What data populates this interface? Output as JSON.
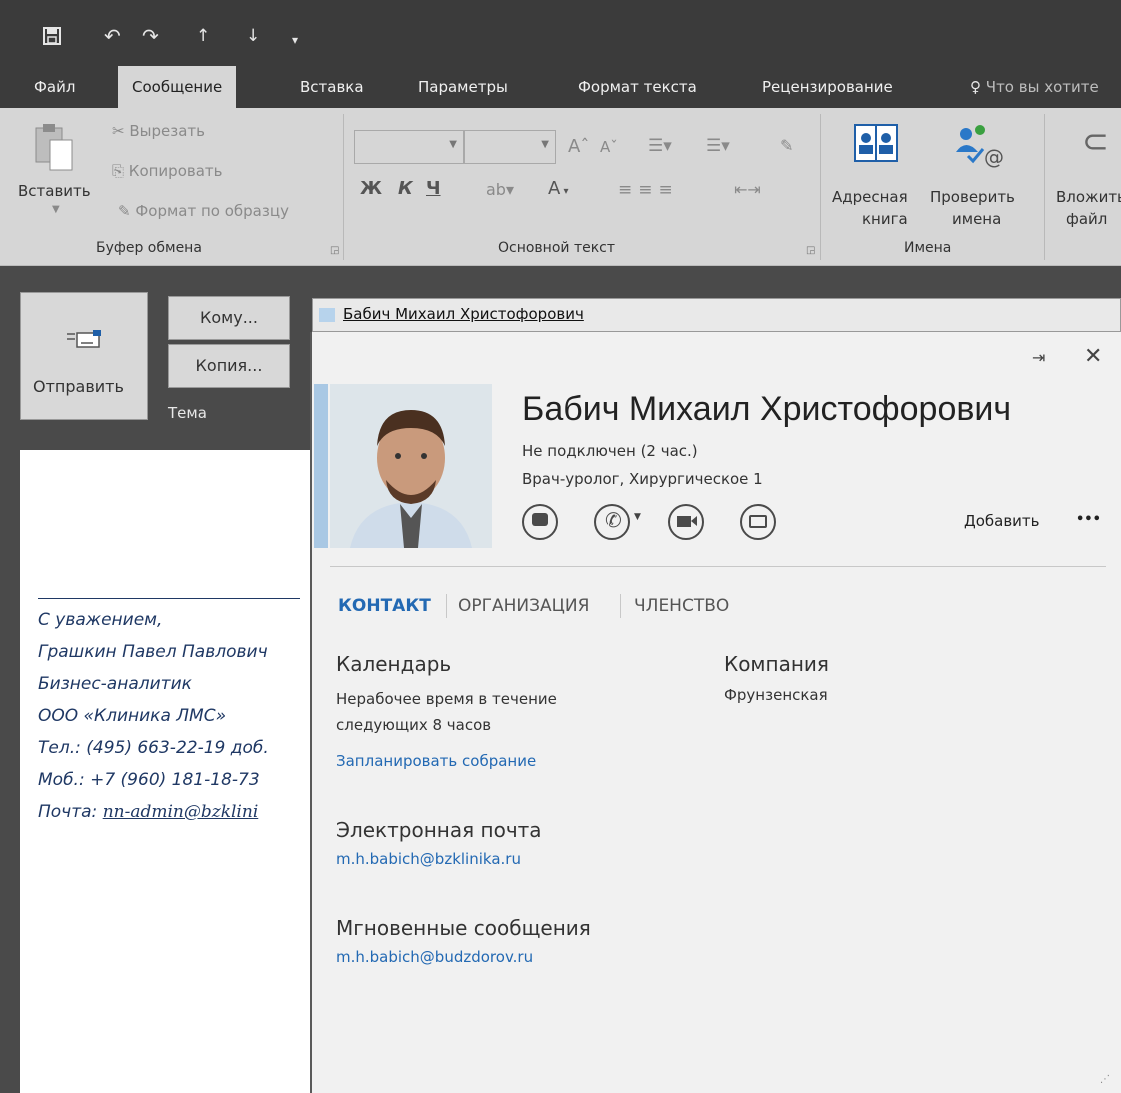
{
  "quick_access": {
    "icons": [
      "save-icon",
      "undo-icon",
      "redo-icon",
      "up-arrow-icon",
      "down-arrow-icon",
      "customize-icon"
    ]
  },
  "tabs": [
    {
      "label": "Файл"
    },
    {
      "label": "Сообщение"
    },
    {
      "label": "Вставка"
    },
    {
      "label": "Параметры"
    },
    {
      "label": "Формат текста"
    },
    {
      "label": "Рецензирование"
    },
    {
      "label": "Что вы хотите"
    }
  ],
  "ribbon": {
    "clipboard": {
      "paste": "Вставить",
      "cut": "Вырезать",
      "copy": "Копировать",
      "format_painter": "Формат по образцу",
      "group_label": "Буфер обмена"
    },
    "basic_text": {
      "bold": "Ж",
      "italic": "К",
      "underline": "Ч",
      "font_color": "A",
      "grow": "A",
      "shrink": "A",
      "group_label": "Основной текст"
    },
    "names": {
      "address_book_1": "Адресная",
      "address_book_2": "книга",
      "check_names_1": "Проверить",
      "check_names_2": "имена",
      "group_label": "Имена"
    },
    "include": {
      "attach_1": "Вложить",
      "attach_2": "файл"
    }
  },
  "compose": {
    "send": "Отправить",
    "to": "Кому...",
    "cc": "Копия...",
    "subject_label": "Тема",
    "recipient": "Бабич Михаил Христофорович",
    "signature": {
      "greeting": "С уважением,",
      "name": "Грашкин Павел Павлович",
      "title": "Бизнес-аналитик",
      "company": "ООО «Клиника ЛМС»",
      "phone": "Тел.: (495) 663-22-19 доб.",
      "mobile": "Моб.: +7 (960) 181-18-73",
      "email_label": "Почта:",
      "email": "nn-admin@bzklini"
    }
  },
  "card": {
    "name": "Бабич Михаил Христофорович",
    "status": "Не подключен (2 час.)",
    "position": "Врач-уролог, Хирургическое 1",
    "add": "Добавить",
    "more": "•••",
    "tabs": [
      "КОНТАКТ",
      "ОРГАНИЗАЦИЯ",
      "ЧЛЕНСТВО"
    ],
    "calendar": {
      "title": "Календарь",
      "line1": "Нерабочее время в течение",
      "line2": "следующих 8 часов",
      "schedule_link": "Запланировать собрание"
    },
    "company": {
      "title": "Компания",
      "value": "Фрунзенская"
    },
    "email": {
      "title": "Электронная почта",
      "value": "m.h.babich@bzklinika.ru"
    },
    "im": {
      "title": "Мгновенные сообщения",
      "value": "m.h.babich@budzdorov.ru"
    }
  },
  "colors": {
    "accent": "#2369b3",
    "signature": "#1f3864",
    "dark_bg": "#3b3b3b",
    "ribbon_bg": "#d6d6d6"
  }
}
